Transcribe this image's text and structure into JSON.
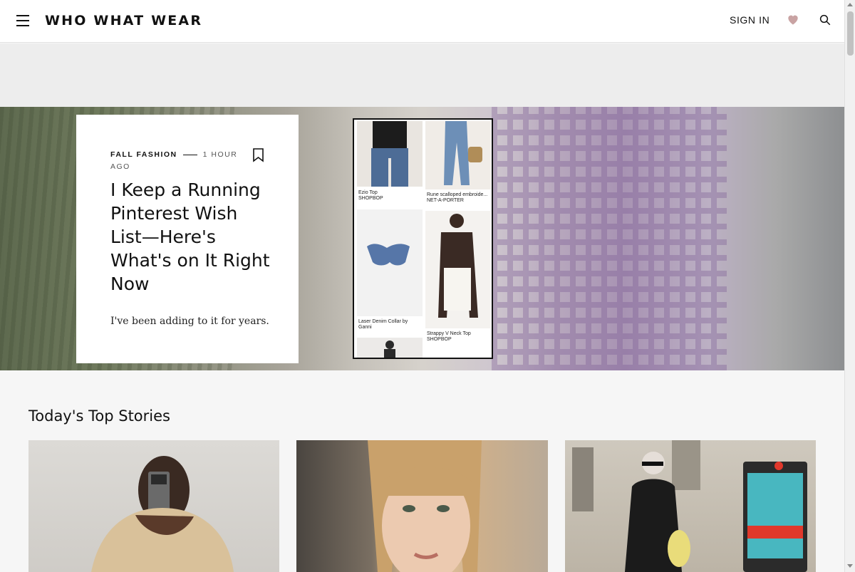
{
  "header": {
    "logo": "WHO WHAT WEAR",
    "sign_in_label": "SIGN IN",
    "icons": [
      "menu-icon",
      "heart-icon",
      "search-icon"
    ],
    "heart_color": "#c9a3a3"
  },
  "hero": {
    "category": "FALL FASHION",
    "time": "1 HOUR AGO",
    "headline": "I Keep a Running Pinterest Wish List—Here's What's on It Right Now",
    "dek": "I've been adding to it for years.",
    "collage": {
      "items": [
        {
          "name": "Ezio Top",
          "retailer": "SHOPBOP"
        },
        {
          "name": "Rune scalloped embroide...",
          "retailer": "NET-A-PORTER"
        },
        {
          "name": "Laser Denim Collar by Ganni",
          "retailer": ""
        },
        {
          "name": "Strappy V Neck Top",
          "retailer": "SHOPBOP"
        }
      ]
    }
  },
  "top_stories": {
    "title": "Today's Top Stories"
  }
}
